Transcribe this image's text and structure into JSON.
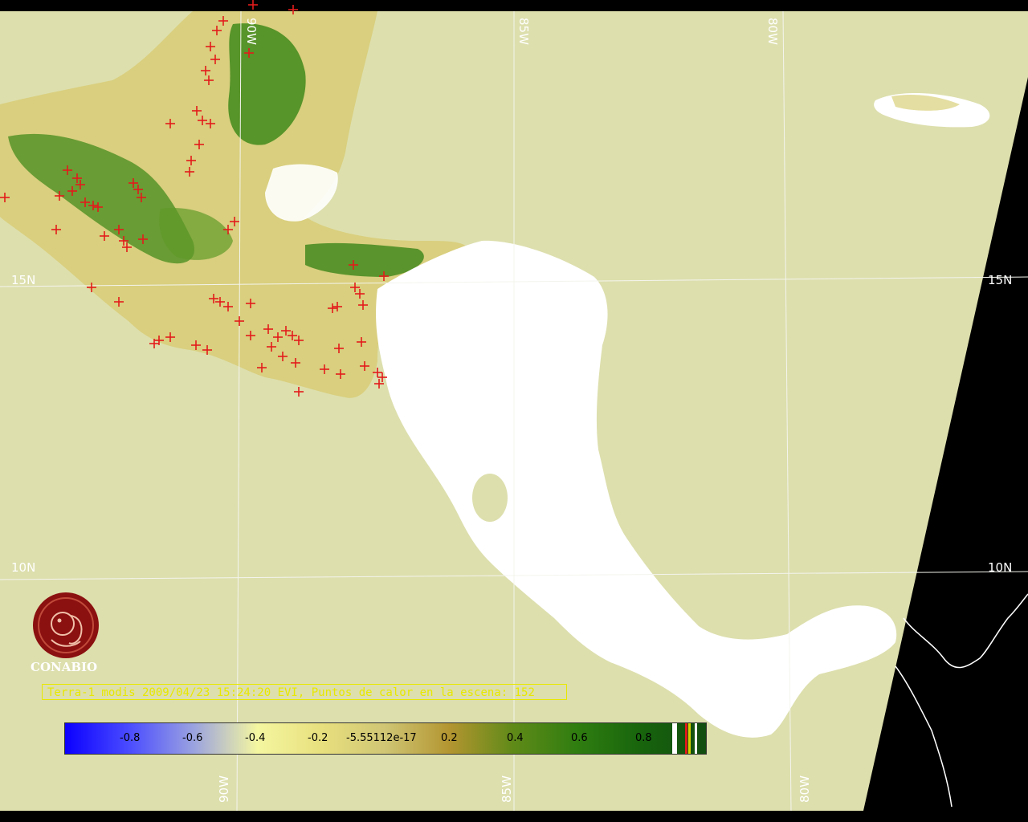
{
  "colors": {
    "ocean": "#dddfad",
    "background": "#000000",
    "land_cloud": "#ffffff",
    "land_sparse": "#d8d07a",
    "land_veg": "#2e7a12",
    "fire_marker": "#e31b1b",
    "grid": "#f4f4ee",
    "caption": "#e8e800",
    "logo": "#8b1010"
  },
  "grid_labels": {
    "lon_90_top": "90W",
    "lon_85_top": "85W",
    "lon_80_top": "80W",
    "lat_15_left": "15N",
    "lat_15_right": "15N",
    "lat_10_left": "10N",
    "lat_10_right": "10N",
    "lon_90_bottom": "90W",
    "lon_85_bottom": "85W",
    "lon_80_bottom": "80W"
  },
  "caption": "Terra-1 modis 2009/04/23 15:24:20 EVI, Puntos de calor en la escena: 152",
  "logo_text": "CONABIO",
  "colorbar": {
    "ticks": [
      "-0.8",
      "-0.6",
      "-0.4",
      "-0.2",
      "-5.55112e-17",
      "0.2",
      "0.4",
      "0.6",
      "0.8"
    ]
  }
}
